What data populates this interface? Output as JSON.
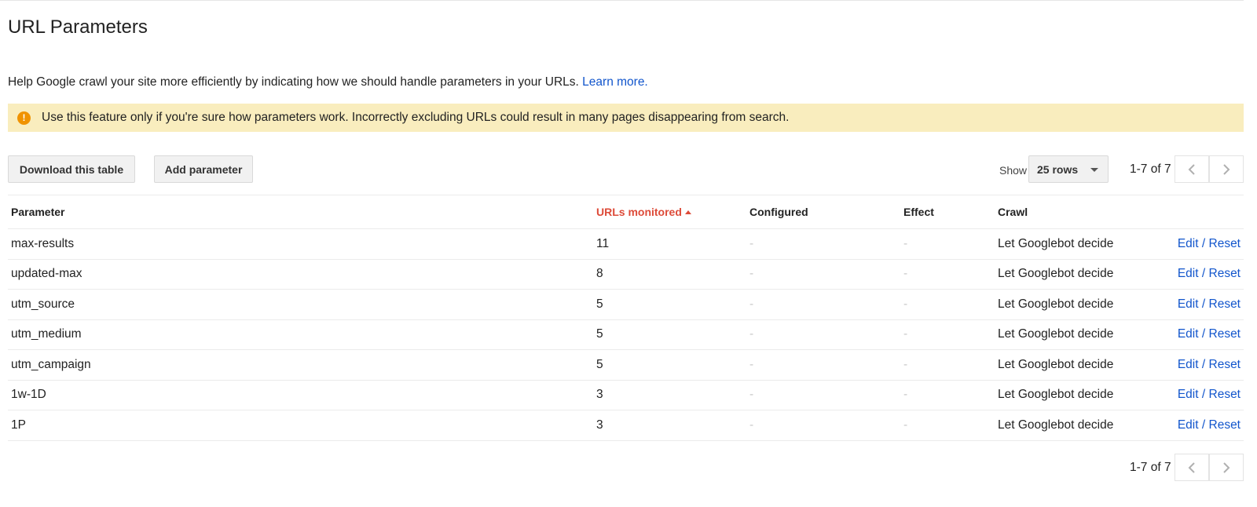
{
  "page": {
    "title": "URL Parameters",
    "help_text": "Help Google crawl your site more efficiently by indicating how we should handle parameters in your URLs.",
    "learn_more": "Learn more.",
    "warning": "Use this feature only if you're sure how parameters work. Incorrectly excluding URLs could result in many pages disappearing from search.",
    "warning_icon": "!"
  },
  "toolbar": {
    "download_label": "Download this table",
    "add_label": "Add parameter",
    "show_label": "Show",
    "rows_value": "25 rows",
    "page_count": "1-7 of 7"
  },
  "table": {
    "headers": {
      "parameter": "Parameter",
      "urls_monitored": "URLs monitored",
      "configured": "Configured",
      "effect": "Effect",
      "crawl": "Crawl"
    },
    "rows": [
      {
        "parameter": "max-results",
        "urls": "11",
        "configured": "-",
        "effect": "-",
        "crawl": "Let Googlebot decide",
        "edit": "Edit",
        "sep": "/",
        "reset": "Reset"
      },
      {
        "parameter": "updated-max",
        "urls": "8",
        "configured": "-",
        "effect": "-",
        "crawl": "Let Googlebot decide",
        "edit": "Edit",
        "sep": "/",
        "reset": "Reset"
      },
      {
        "parameter": "utm_source",
        "urls": "5",
        "configured": "-",
        "effect": "-",
        "crawl": "Let Googlebot decide",
        "edit": "Edit",
        "sep": "/",
        "reset": "Reset"
      },
      {
        "parameter": "utm_medium",
        "urls": "5",
        "configured": "-",
        "effect": "-",
        "crawl": "Let Googlebot decide",
        "edit": "Edit",
        "sep": "/",
        "reset": "Reset"
      },
      {
        "parameter": "utm_campaign",
        "urls": "5",
        "configured": "-",
        "effect": "-",
        "crawl": "Let Googlebot decide",
        "edit": "Edit",
        "sep": "/",
        "reset": "Reset"
      },
      {
        "parameter": "1w-1D",
        "urls": "3",
        "configured": "-",
        "effect": "-",
        "crawl": "Let Googlebot decide",
        "edit": "Edit",
        "sep": "/",
        "reset": "Reset"
      },
      {
        "parameter": "1P",
        "urls": "3",
        "configured": "-",
        "effect": "-",
        "crawl": "Let Googlebot decide",
        "edit": "Edit",
        "sep": "/",
        "reset": "Reset"
      }
    ]
  },
  "footer": {
    "page_count": "1-7 of 7"
  },
  "colors": {
    "link": "#1155cc",
    "sorted_header": "#dd4b39",
    "warning_bg": "#f9edbe",
    "warning_icon": "#f09300"
  },
  "icons": {
    "warning": "warning-circle-icon",
    "prev": "chevron-left-icon",
    "next": "chevron-right-icon",
    "dropdown": "caret-down-icon",
    "sort": "sort-ascending-icon"
  }
}
